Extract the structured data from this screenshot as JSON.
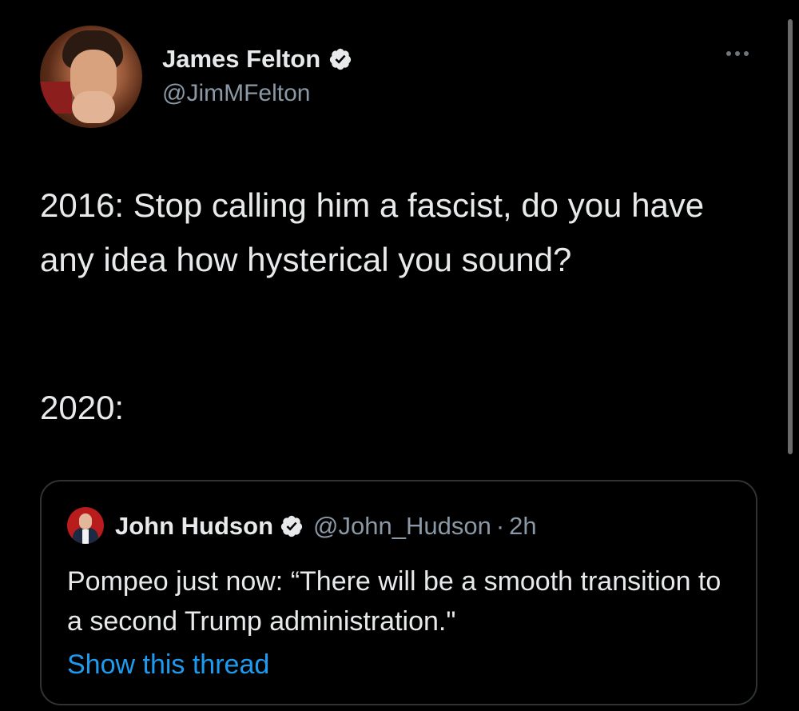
{
  "tweet": {
    "display_name": "James Felton",
    "handle": "@JimMFelton",
    "text_line1": "2016: Stop calling him a fascist, do you have any idea how hysterical you sound?",
    "text_line2": "2020:"
  },
  "quote": {
    "display_name": "John Hudson",
    "handle": "@John_Hudson",
    "separator": "·",
    "time": "2h",
    "text": "Pompeo just now: “There will be a smooth transition to a second Trump administration.\"",
    "show_thread_label": "Show this thread"
  },
  "icons": {
    "verified": "verified-badge-icon",
    "more": "more-options-icon"
  },
  "colors": {
    "background": "#000000",
    "primary_text": "#e7e9ea",
    "secondary_text": "#8b98a5",
    "link": "#1d9bf0",
    "border": "#2f3336"
  }
}
